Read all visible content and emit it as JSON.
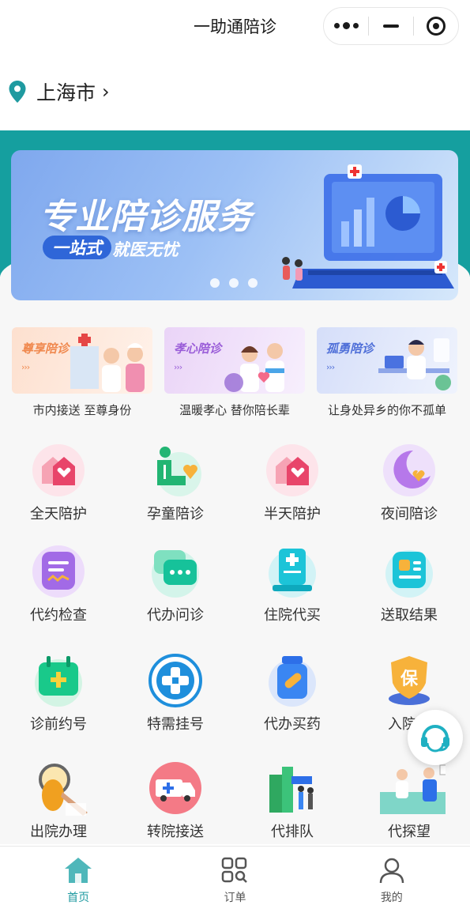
{
  "app": {
    "title": "一助通陪诊"
  },
  "location": {
    "city": "上海市"
  },
  "banner": {
    "title": "专业陪诊服务",
    "pill": "一站式",
    "subtitle": "就医无忧",
    "slides": 3,
    "active_slide": 0
  },
  "services": [
    {
      "tag": "尊享陪诊",
      "caption": "市内接送 至尊身份",
      "color": "#f0894f",
      "bg": "#fde3d5"
    },
    {
      "tag": "孝心陪诊",
      "caption": "温暖孝心 替你陪长辈",
      "color": "#9a5dd8",
      "bg": "#ead9f6"
    },
    {
      "tag": "孤勇陪诊",
      "caption": "让身处异乡的你不孤单",
      "color": "#4f6fd8",
      "bg": "#dbe3fb"
    }
  ],
  "grid": [
    {
      "label": "全天陪护",
      "icon": "house-heart-icon"
    },
    {
      "label": "孕童陪诊",
      "icon": "mother-child-icon"
    },
    {
      "label": "半天陪护",
      "icon": "house-heart-icon"
    },
    {
      "label": "夜间陪诊",
      "icon": "moon-heart-icon"
    },
    {
      "label": "代约检查",
      "icon": "document-wave-icon"
    },
    {
      "label": "代办问诊",
      "icon": "chat-bubble-icon"
    },
    {
      "label": "住院代买",
      "icon": "medical-kit-icon"
    },
    {
      "label": "送取结果",
      "icon": "report-card-icon"
    },
    {
      "label": "诊前约号",
      "icon": "calendar-plus-icon"
    },
    {
      "label": "特需挂号",
      "icon": "medical-cross-badge-icon"
    },
    {
      "label": "代办买药",
      "icon": "pill-bottle-icon"
    },
    {
      "label": "入院办",
      "icon": "insurance-shield-icon"
    },
    {
      "label": "出院办理",
      "icon": "magnifier-document-icon"
    },
    {
      "label": "转院接送",
      "icon": "ambulance-icon"
    },
    {
      "label": "代排队",
      "icon": "queue-people-icon"
    },
    {
      "label": "代探望",
      "icon": "visit-patient-icon"
    }
  ],
  "tabs": [
    {
      "label": "首页",
      "icon": "home-icon",
      "active": true
    },
    {
      "label": "订单",
      "icon": "order-grid-icon",
      "active": false
    },
    {
      "label": "我的",
      "icon": "user-icon",
      "active": false
    }
  ],
  "colors": {
    "brand_teal": "#159f9f",
    "tab_active": "#1f9aa0"
  }
}
